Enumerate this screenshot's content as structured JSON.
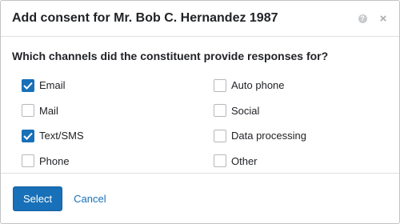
{
  "dialog": {
    "title": "Add consent for Mr. Bob C. Hernandez 1987",
    "help_icon": "help-icon",
    "close_icon": "close-icon",
    "help_glyph": "?",
    "close_glyph": "×"
  },
  "question": "Which channels did the constituent provide responses for?",
  "channels": [
    {
      "label": "Email",
      "checked": true
    },
    {
      "label": "Auto phone",
      "checked": false
    },
    {
      "label": "Mail",
      "checked": false
    },
    {
      "label": "Social",
      "checked": false
    },
    {
      "label": "Text/SMS",
      "checked": true
    },
    {
      "label": "Data processing",
      "checked": false
    },
    {
      "label": "Phone",
      "checked": false
    },
    {
      "label": "Other",
      "checked": false
    }
  ],
  "footer": {
    "select_label": "Select",
    "cancel_label": "Cancel"
  },
  "colors": {
    "accent": "#1870b8",
    "border": "#c2c3c5"
  }
}
